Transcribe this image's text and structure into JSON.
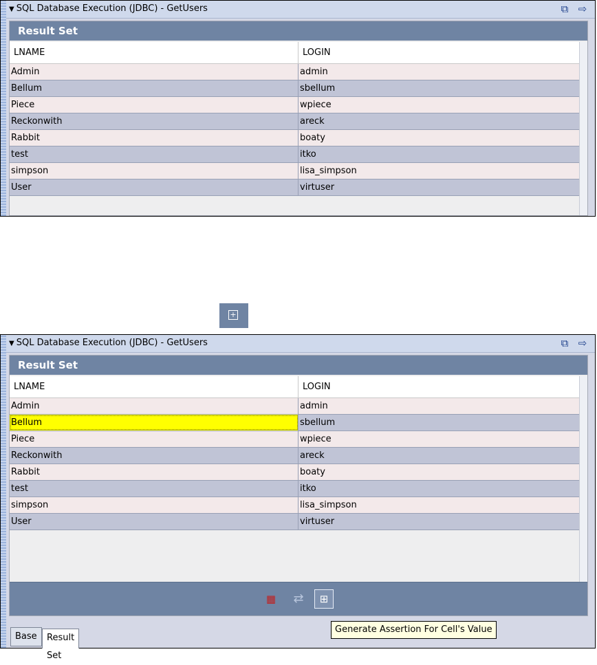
{
  "panel_title": "SQL Database Execution (JDBC) - GetUsers",
  "result_set_label": "Result Set",
  "columns": [
    "LNAME",
    "LOGIN"
  ],
  "rows": [
    [
      "Admin",
      "admin"
    ],
    [
      "Bellum",
      "sbellum"
    ],
    [
      "Piece",
      "wpiece"
    ],
    [
      "Reckonwith",
      "areck"
    ],
    [
      "Rabbit",
      "boaty"
    ],
    [
      "test",
      "itko"
    ],
    [
      "simpson",
      "lisa_simpson"
    ],
    [
      "User",
      "virtuser"
    ]
  ],
  "selected_cell": {
    "row": 1,
    "column": 0
  },
  "tabs": [
    "Base",
    "Result Set"
  ],
  "active_tab": "Result Set",
  "tooltip": "Generate Assertion For Cell's Value",
  "icons": {
    "title_left": "collapse-triangle-icon",
    "title_right": [
      "detach-window-icon",
      "navigate-arrow-icon"
    ],
    "toolbar": [
      "table-grid-icon",
      "swap-arrows-icon",
      "generate-assertion-icon"
    ]
  },
  "colors": {
    "header_bar": "#6f84a3",
    "row_odd": "#f3e9ea",
    "row_even": "#c0c4d6",
    "selection": "#ffff00",
    "tooltip_bg": "#ffffe1"
  }
}
